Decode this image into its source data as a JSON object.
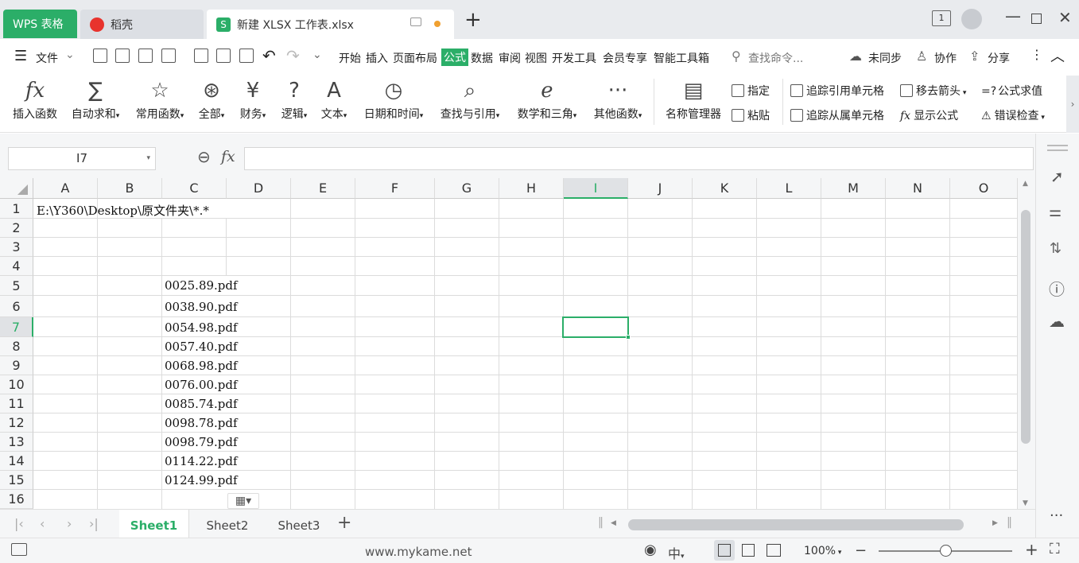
{
  "tabs": {
    "wps": "WPS 表格",
    "daoke": "稻壳",
    "doc": "新建 XLSX 工作表.xlsx"
  },
  "menu": {
    "file": "文件",
    "items": [
      "开始",
      "插入",
      "页面布局",
      "公式",
      "数据",
      "审阅",
      "视图",
      "开发工具",
      "会员专享",
      "智能工具箱"
    ],
    "search_placeholder": "查找命令...",
    "sync": "未同步",
    "collab": "协作",
    "share": "分享"
  },
  "ribbon": {
    "insert_func": "插入函数",
    "autosum": "自动求和",
    "common": "常用函数",
    "all": "全部",
    "finance": "财务",
    "logic": "逻辑",
    "text": "文本",
    "datetime": "日期和时间",
    "lookup": "查找与引用",
    "math": "数学和三角",
    "other": "其他函数",
    "name_mgr": "名称管理器",
    "define": "指定",
    "paste": "粘贴",
    "trace_prec": "追踪引用单元格",
    "remove_arrows": "移去箭头",
    "eval": "公式求值",
    "trace_dep": "追踪从属单元格",
    "show_formula": "显示公式",
    "error_check": "错误检查"
  },
  "namebox": "I7",
  "columns": [
    "A",
    "B",
    "C",
    "D",
    "E",
    "F",
    "G",
    "H",
    "I",
    "J",
    "K",
    "L",
    "M",
    "N",
    "O"
  ],
  "rows": [
    "1",
    "2",
    "3",
    "4",
    "5",
    "6",
    "7",
    "8",
    "9",
    "10",
    "11",
    "12",
    "13",
    "14",
    "15",
    "16"
  ],
  "cells": {
    "a1": "E:\\Y360\\Desktop\\原文件夹\\*.*",
    "c5": "0025.89.pdf",
    "c6": "0038.90.pdf",
    "c7": "0054.98.pdf",
    "c8": "0057.40.pdf",
    "c9": "0068.98.pdf",
    "c10": "0076.00.pdf",
    "c11": "0085.74.pdf",
    "c12": "0098.78.pdf",
    "c13": "0098.79.pdf",
    "c14": "0114.22.pdf",
    "c15": "0124.99.pdf"
  },
  "sheets": [
    "Sheet1",
    "Sheet2",
    "Sheet3"
  ],
  "status": {
    "watermark": "www.mykame.net",
    "zoom": "100%",
    "zoom_level": 0.5,
    "input_method": "中"
  },
  "colors": {
    "accent": "#2bae68",
    "danger": "#e8332d"
  }
}
